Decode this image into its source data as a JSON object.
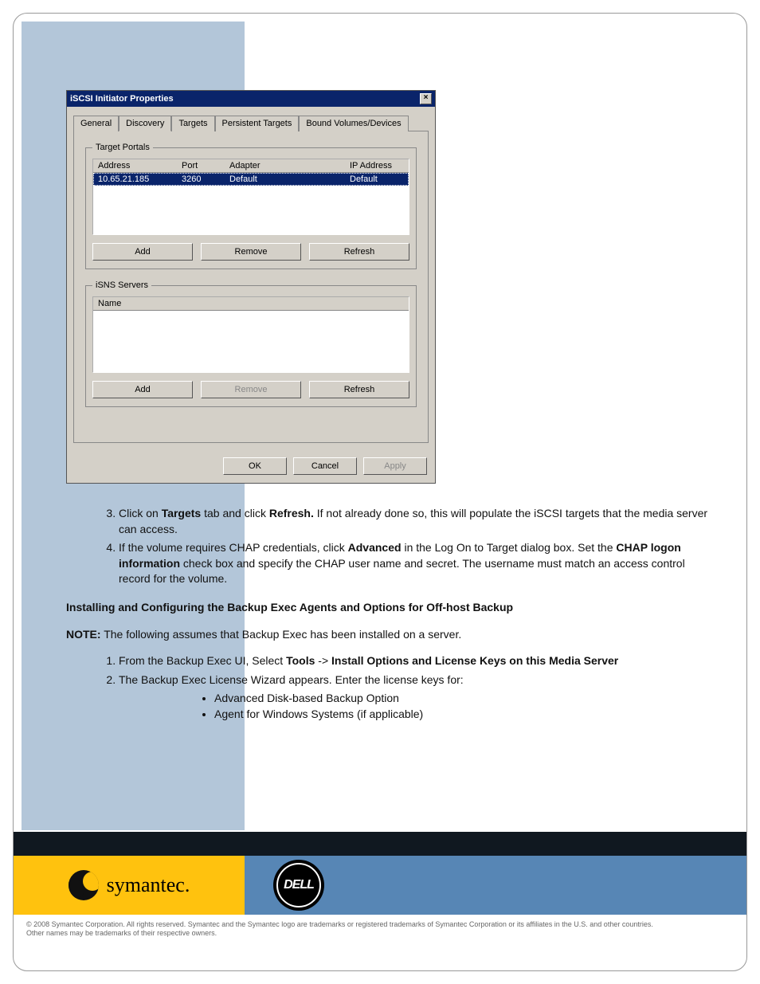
{
  "dialog": {
    "title": "iSCSI Initiator Properties",
    "tabs": [
      "General",
      "Discovery",
      "Targets",
      "Persistent Targets",
      "Bound Volumes/Devices"
    ],
    "active_tab_index": 1,
    "target_portals": {
      "legend": "Target Portals",
      "columns": [
        "Address",
        "Port",
        "Adapter",
        "IP Address"
      ],
      "rows": [
        {
          "address": "10.65.21.185",
          "port": "3260",
          "adapter": "Default",
          "ip": "Default"
        }
      ],
      "buttons": {
        "add": "Add",
        "remove": "Remove",
        "refresh": "Refresh"
      },
      "remove_disabled": false
    },
    "isns": {
      "legend": "iSNS Servers",
      "columns": [
        "Name"
      ],
      "buttons": {
        "add": "Add",
        "remove": "Remove",
        "refresh": "Refresh"
      },
      "remove_disabled": true
    },
    "footer": {
      "ok": "OK",
      "cancel": "Cancel",
      "apply": "Apply",
      "apply_disabled": true
    }
  },
  "doc": {
    "step3_num": "3.",
    "step3_a": "Click on ",
    "step3_b": "Targets",
    "step3_c": " tab and click ",
    "step3_d": "Refresh.",
    "step3_e": "  If not already done so, this will populate the iSCSI targets that the media server can access.",
    "step4_num": "4.",
    "step4_a": "If the volume requires CHAP credentials, click ",
    "step4_b": "Advanced",
    "step4_c": " in the Log On to Target dialog box.  Set the ",
    "step4_d": "CHAP logon information",
    "step4_e": " check box and specify the CHAP user name and secret.  The username must match an access control record for the volume.",
    "heading2": "Installing and Configuring the Backup Exec Agents and Options for Off-host Backup",
    "note_label": "NOTE:",
    "note_text": " The following assumes that Backup Exec has been installed on a server.",
    "ol2_1a": "From the Backup Exec UI, Select ",
    "ol2_1b": "Tools",
    "ol2_1c": " -> ",
    "ol2_1d": "Install Options and License Keys on this Media Server",
    "ol2_2": "The Backup Exec License Wizard appears.  Enter the license keys for:",
    "bullets": [
      "Advanced Disk-based Backup Option",
      "Agent for Windows Systems (if applicable)"
    ]
  },
  "brand": {
    "symantec": "symantec.",
    "dell": "DELL"
  },
  "legal": {
    "line1": "©  2008  Symantec  Corporation.  All  rights  reserved.  Symantec  and  the  Symantec  logo  are  trademarks  or  registered  trademarks  of  Symantec  Corporation  or  its  affiliates  in  the  U.S.  and  other  countries.",
    "line2": "Other names may be trademarks of their respective owners."
  }
}
